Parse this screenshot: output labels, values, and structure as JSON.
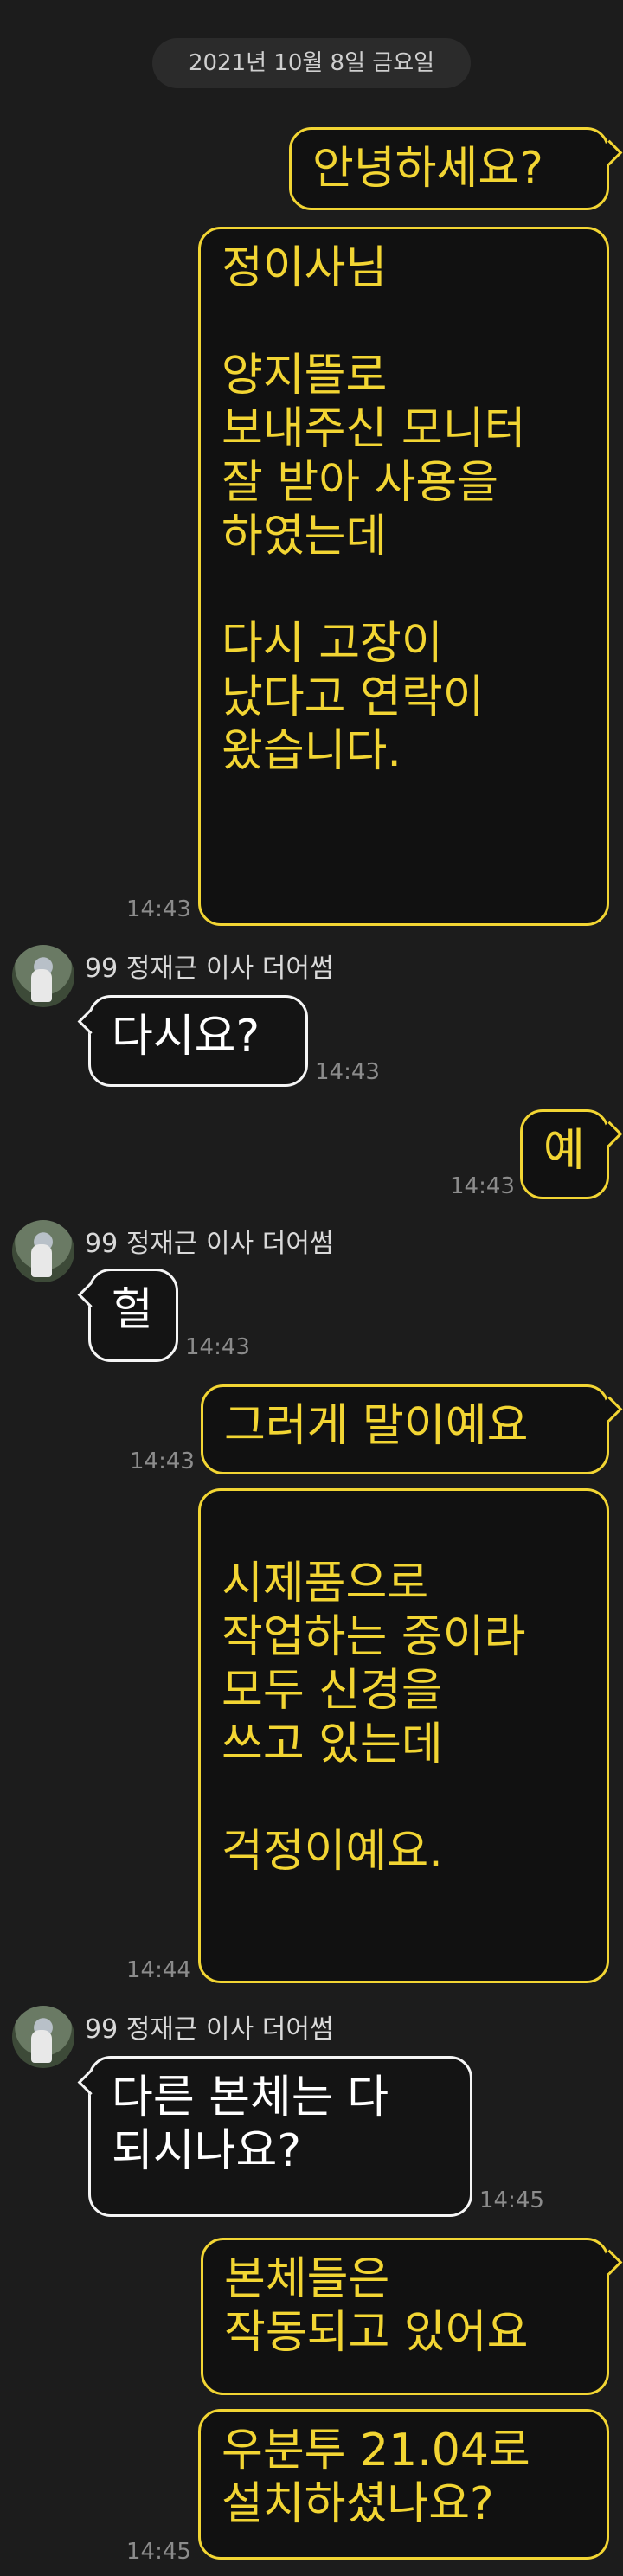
{
  "chat": {
    "date_separator": "2021년 10월 8일 금요일",
    "sender_name": "99 정재근 이사 더어썸",
    "messages": [
      {
        "from": "me",
        "text": "안녕하세요?",
        "time": ""
      },
      {
        "from": "me",
        "text": "정이사님\n\n양지뜰로\n보내주신 모니터\n잘 받아 사용을\n하였는데\n\n다시 고장이\n났다고 연락이\n왔습니다.",
        "time": "14:43"
      },
      {
        "from": "them",
        "text": "다시요?",
        "time": "14:43"
      },
      {
        "from": "me",
        "text": "예",
        "time": "14:43"
      },
      {
        "from": "them",
        "text": "헐",
        "time": "14:43"
      },
      {
        "from": "me",
        "text": "그러게 말이예요",
        "time": "14:43"
      },
      {
        "from": "me",
        "text": "\n 시제품으로\n작업하는 중이라\n모두 신경을\n쓰고 있는데\n\n걱정이예요.",
        "time": "14:44"
      },
      {
        "from": "them",
        "text": "다른 본체는 다\n되시나요?",
        "time": "14:45"
      },
      {
        "from": "me",
        "text": "본체들은\n작동되고 있어요",
        "time": ""
      },
      {
        "from": "me",
        "text": "우분투 21.04로\n설치하셨나요?",
        "time": "14:45"
      }
    ]
  },
  "colors": {
    "background": "#1c1c1c",
    "my_bubble_text": "#f2d533",
    "their_bubble_border": "#f5f5f5"
  },
  "icons": {
    "avatar": "profile-photo"
  }
}
